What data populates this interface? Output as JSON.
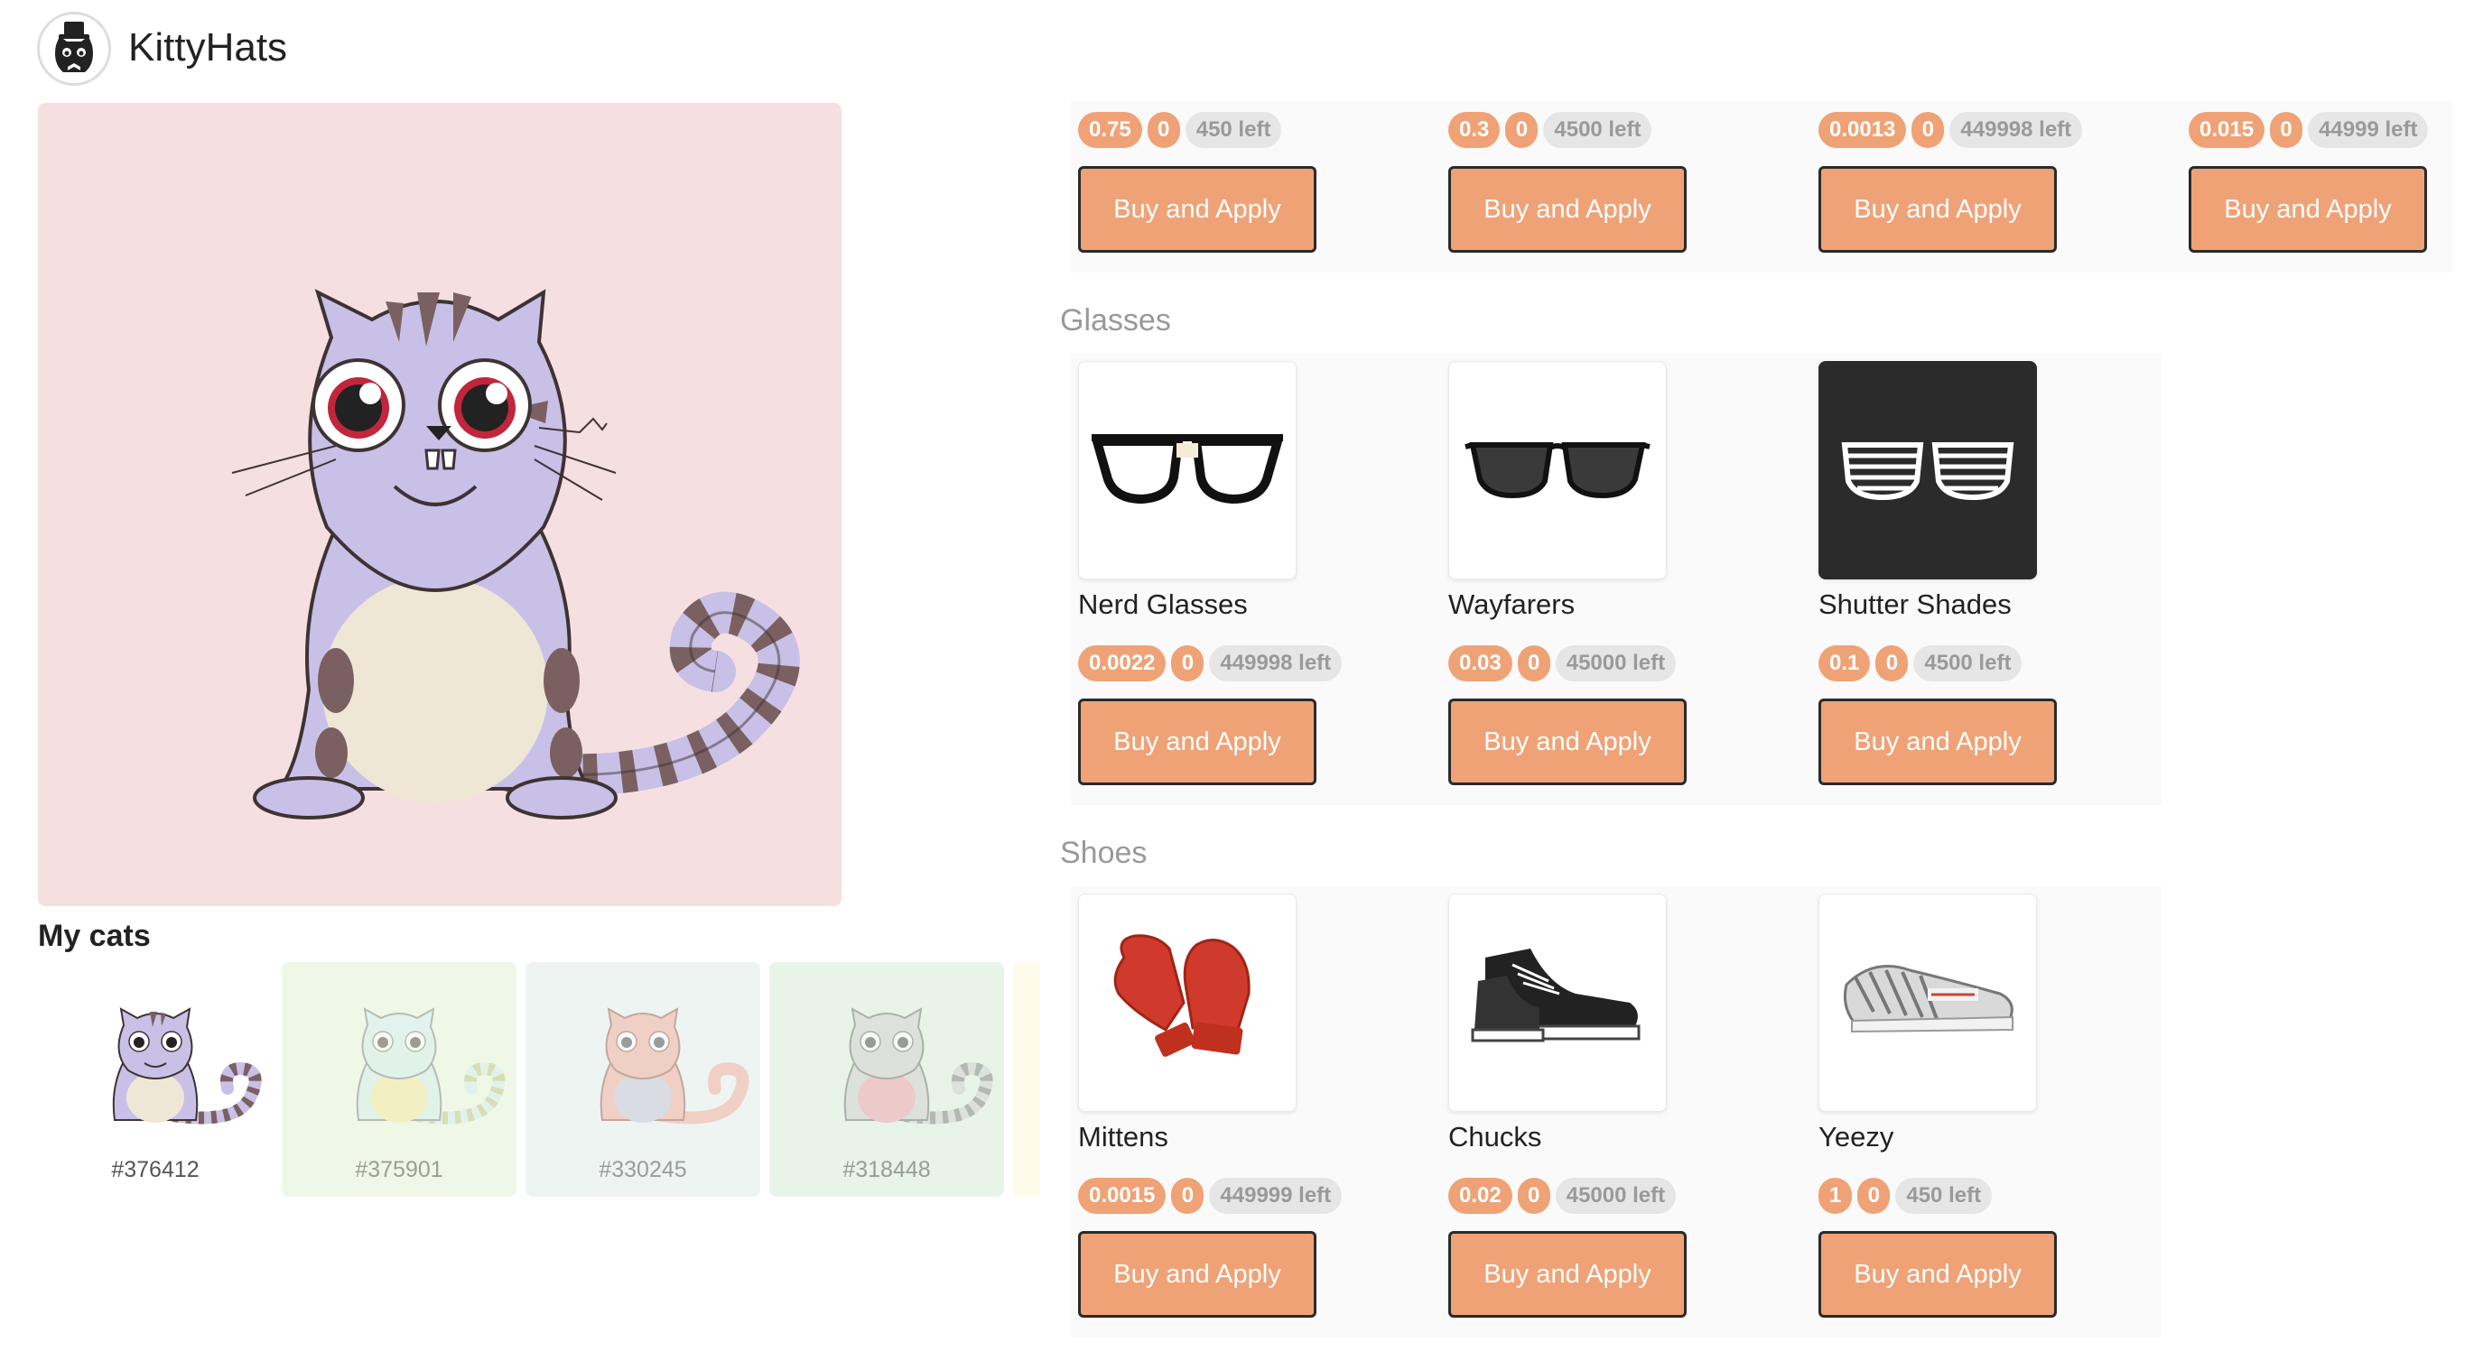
{
  "app": {
    "title": "KittyHats"
  },
  "hero": {
    "cat_name": "selected-cat"
  },
  "my_cats": {
    "title": "My cats",
    "cats": [
      {
        "id": "#376412",
        "bg": "#ffffff",
        "body": "#c9c0e8",
        "belly": "#efe7d6",
        "stripe": "#7a6060"
      },
      {
        "id": "#375901",
        "bg": "#eff8e6",
        "body": "#d6eef0",
        "belly": "#f6e9a8",
        "stripe": "#c7c98a"
      },
      {
        "id": "#330245",
        "bg": "#eef4f2",
        "body": "#f2b3a2",
        "belly": "#c9c9d8",
        "stripe": "#e09a86"
      },
      {
        "id": "#318448",
        "bg": "#e8f4e8",
        "body": "#d3d3d3",
        "belly": "#f2a8b0",
        "stripe": "#8a8a8a"
      }
    ]
  },
  "top_row": [
    {
      "price": "0.75",
      "count": "0",
      "left": "450 left",
      "button": "Buy and Apply"
    },
    {
      "price": "0.3",
      "count": "0",
      "left": "4500 left",
      "button": "Buy and Apply"
    },
    {
      "price": "0.0013",
      "count": "0",
      "left": "449998 left",
      "button": "Buy and Apply"
    },
    {
      "price": "0.015",
      "count": "0",
      "left": "44999 left",
      "button": "Buy and Apply"
    }
  ],
  "sections": [
    {
      "title": "Glasses",
      "items": [
        {
          "name": "Nerd Glasses",
          "icon": "nerd-glasses-icon",
          "price": "0.0022",
          "count": "0",
          "left": "449998 left",
          "button": "Buy and Apply"
        },
        {
          "name": "Wayfarers",
          "icon": "wayfarers-icon",
          "price": "0.03",
          "count": "0",
          "left": "45000 left",
          "button": "Buy and Apply"
        },
        {
          "name": "Shutter Shades",
          "icon": "shutter-shades-icon",
          "price": "0.1",
          "count": "0",
          "left": "4500 left",
          "button": "Buy and Apply"
        }
      ]
    },
    {
      "title": "Shoes",
      "items": [
        {
          "name": "Mittens",
          "icon": "mittens-icon",
          "price": "0.0015",
          "count": "0",
          "left": "449999 left",
          "button": "Buy and Apply"
        },
        {
          "name": "Chucks",
          "icon": "chucks-icon",
          "price": "0.02",
          "count": "0",
          "left": "45000 left",
          "button": "Buy and Apply"
        },
        {
          "name": "Yeezy",
          "icon": "yeezy-icon",
          "price": "1",
          "count": "0",
          "left": "450 left",
          "button": "Buy and Apply"
        }
      ]
    }
  ],
  "colors": {
    "accent": "#f0a277",
    "hero_bg": "#f6dfe0",
    "section_title": "#999999"
  }
}
